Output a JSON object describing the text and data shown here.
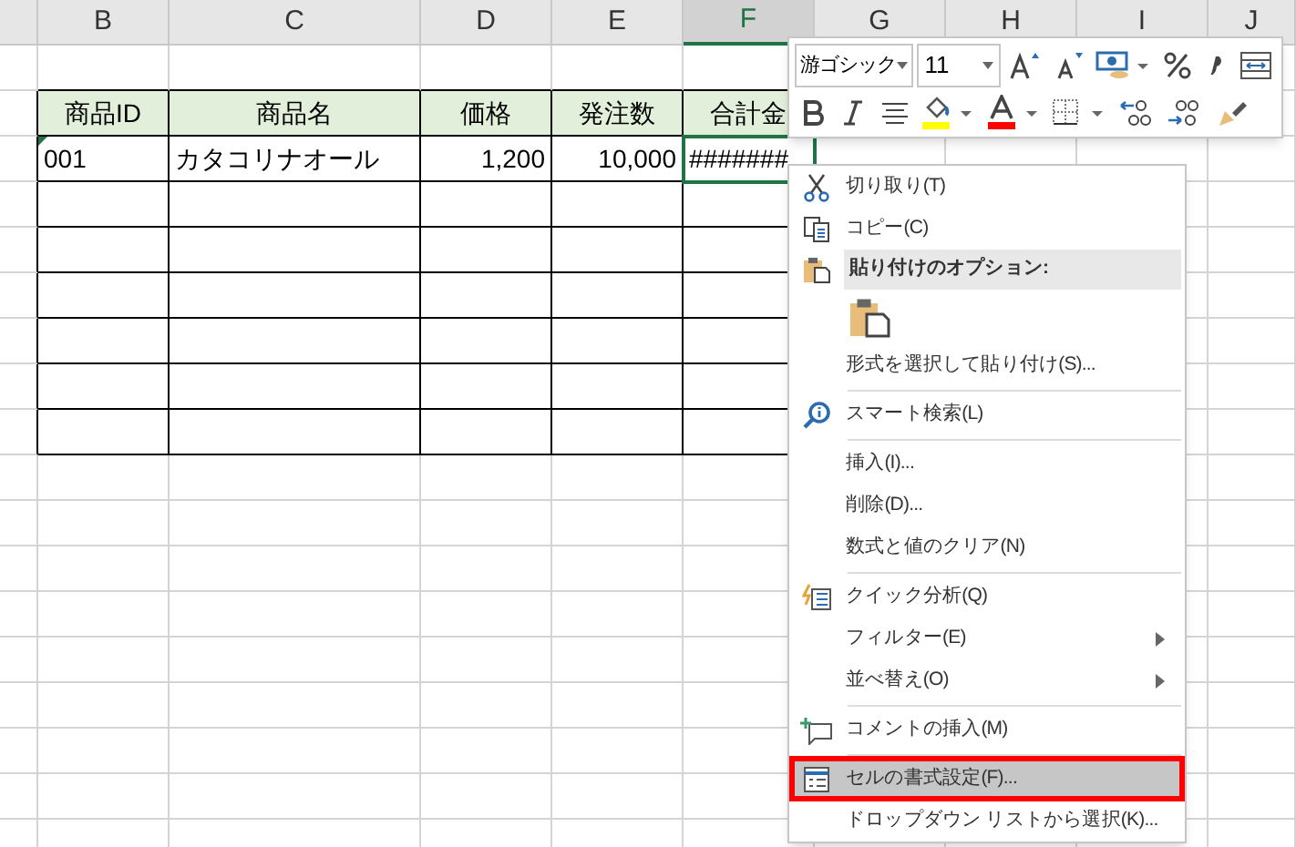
{
  "columns": [
    {
      "label": "B",
      "selected": false
    },
    {
      "label": "C",
      "selected": false
    },
    {
      "label": "D",
      "selected": false
    },
    {
      "label": "E",
      "selected": false
    },
    {
      "label": "F",
      "selected": true
    },
    {
      "label": "G",
      "selected": false
    },
    {
      "label": "H",
      "selected": false
    },
    {
      "label": "I",
      "selected": false
    },
    {
      "label": "J",
      "selected": false
    }
  ],
  "table": {
    "header": [
      "商品ID",
      "商品名",
      "価格",
      "発注数",
      "合計金"
    ],
    "rows": [
      {
        "cells": [
          {
            "text": "001",
            "error_mark": true,
            "selected": false
          },
          {
            "text": "カタコリナオール",
            "error_mark": false,
            "selected": false
          },
          {
            "text": "1,200",
            "error_mark": false,
            "selected": false
          },
          {
            "text": "10,000",
            "error_mark": false,
            "selected": false
          },
          {
            "text": "#######",
            "error_mark": false,
            "selected": true
          }
        ]
      }
    ]
  },
  "mini_toolbar": {
    "font": "游ゴシック",
    "size": "11"
  },
  "context_menu": [
    {
      "kind": "item",
      "label": "切り取り(T)",
      "submenu": false,
      "selected": false
    },
    {
      "kind": "item",
      "label": "コピー(C)",
      "submenu": false,
      "selected": false
    },
    {
      "kind": "heading",
      "label": "貼り付けのオプション:"
    },
    {
      "kind": "paste"
    },
    {
      "kind": "item",
      "label": "形式を選択して貼り付け(S)...",
      "submenu": false,
      "selected": false
    },
    {
      "kind": "separator"
    },
    {
      "kind": "item",
      "label": "スマート検索(L)",
      "submenu": false,
      "selected": false
    },
    {
      "kind": "separator"
    },
    {
      "kind": "item",
      "label": "挿入(I)...",
      "submenu": false,
      "selected": false
    },
    {
      "kind": "item",
      "label": "削除(D)...",
      "submenu": false,
      "selected": false
    },
    {
      "kind": "item",
      "label": "数式と値のクリア(N)",
      "submenu": false,
      "selected": false
    },
    {
      "kind": "separator"
    },
    {
      "kind": "item",
      "label": "クイック分析(Q)",
      "submenu": false,
      "selected": false
    },
    {
      "kind": "item",
      "label": "フィルター(E)",
      "submenu": true,
      "selected": false
    },
    {
      "kind": "item",
      "label": "並べ替え(O)",
      "submenu": true,
      "selected": false
    },
    {
      "kind": "separator"
    },
    {
      "kind": "item",
      "label": "コメントの挿入(M)",
      "submenu": false,
      "selected": false
    },
    {
      "kind": "separator"
    },
    {
      "kind": "item",
      "label": "セルの書式設定(F)...",
      "submenu": false,
      "selected": true
    },
    {
      "kind": "item",
      "label": "ドロップダウン リストから選択(K)...",
      "submenu": false,
      "selected": false
    }
  ]
}
